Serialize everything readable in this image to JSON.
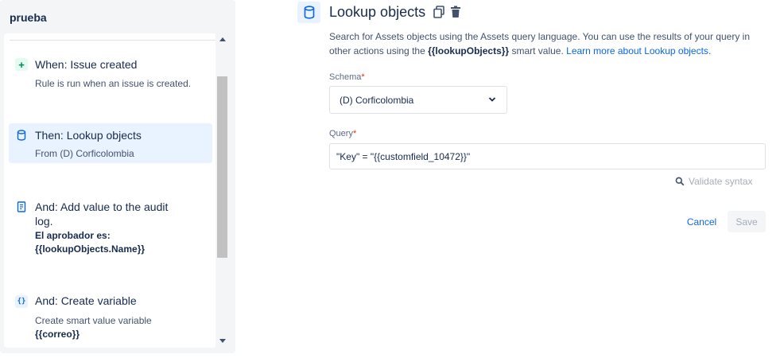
{
  "rule": {
    "name": "prueba"
  },
  "steps": [
    {
      "title": "When: Issue created",
      "desc": "Rule is run when an issue is created.",
      "icon": "plus-icon"
    },
    {
      "title": "Then: Lookup objects",
      "desc": "From (D) Corficolombia",
      "icon": "database-icon",
      "selected": true
    },
    {
      "title_line1": "And: Add value to the audit",
      "title_line2": "log.",
      "desc_line1": "El aprobador es:",
      "desc_line2": "{{lookupObjects.Name}}",
      "icon": "audit-log-icon"
    },
    {
      "title": "And: Create variable",
      "desc": "Create smart value variable",
      "desc_value": "{{correo}}",
      "icon": "braces-icon"
    }
  ],
  "panel": {
    "title": "Lookup objects",
    "description": {
      "part1": "Search for Assets objects using the Assets query language. You can use the results of your query in other actions using the ",
      "smart_value": "{{lookupObjects}}",
      "part2": " smart value. ",
      "link": "Learn more about Lookup objects",
      "part3": "."
    },
    "schema": {
      "label": "Schema",
      "required_mark": "*",
      "value": "(D) Corficolombia"
    },
    "query": {
      "label": "Query",
      "required_mark": "*",
      "value": "\"Key\" = \"{{customfield_10472}}\""
    },
    "validate_label": "Validate syntax",
    "cancel_label": "Cancel",
    "save_label": "Save"
  },
  "colors": {
    "accent": "#0c66e4",
    "selected_bg": "#e9f2ff",
    "required": "#de350b"
  }
}
